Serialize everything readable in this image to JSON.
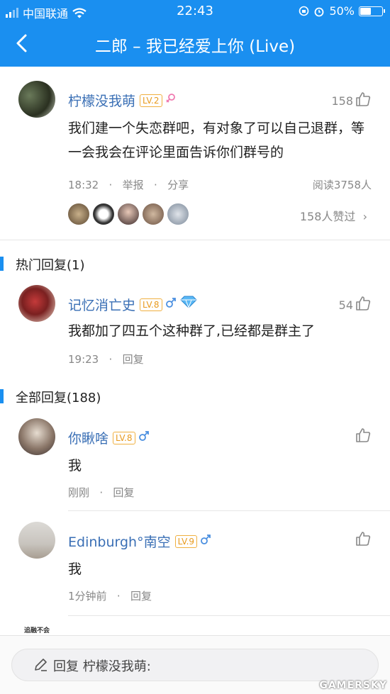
{
  "status_bar": {
    "carrier": "中国联通",
    "time": "22:43",
    "battery": "50%",
    "battery_level": 0.5
  },
  "nav": {
    "title": "二郎 – 我已经爱上你 (Live)"
  },
  "colors": {
    "accent": "#1a8ff0",
    "username": "#3a6fb5",
    "level_badge": "#e89a1e"
  },
  "main_comment": {
    "username": "柠檬没我萌",
    "level": "LV.2",
    "gender_icon": "female-icon",
    "likes": "158",
    "text": "我们建一个失恋群吧，有对象了可以自己退群，等一会我会在评论里面告诉你们群号的",
    "time": "18:32",
    "sep": "·",
    "report": "举报",
    "share": "分享",
    "reads": "阅读3758人",
    "liked_by": "158人赞过"
  },
  "hot_section": {
    "title": "热门回复(1)"
  },
  "hot_reply": {
    "username": "记忆消亡史",
    "level": "LV.8",
    "gender_icon": "male-icon",
    "badge_icon": "diamond-icon",
    "likes": "54",
    "text": "我都加了四五个这种群了,已经都是群主了",
    "time": "19:23",
    "sep": "·",
    "reply": "回复"
  },
  "all_section": {
    "title": "全部回复(188)"
  },
  "replies": [
    {
      "username": "你瞅啥",
      "level": "LV.8",
      "gender_icon": "male-icon",
      "text": "我",
      "time": "刚刚",
      "sep": "·",
      "reply": "回复"
    },
    {
      "username": "Edinburgh°南空",
      "level": "LV.9",
      "gender_icon": "male-icon",
      "text": "我",
      "time": "1分钟前",
      "sep": "·",
      "reply": "回复"
    }
  ],
  "partial_avatar_text": "追融不会",
  "reply_bar": {
    "label": "回复",
    "target": "柠檬没我萌:"
  },
  "watermark": "GAMERSKY"
}
